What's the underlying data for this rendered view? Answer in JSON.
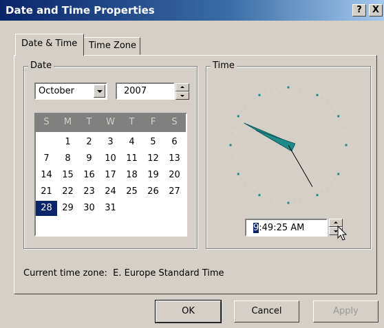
{
  "window": {
    "title": "Date and Time Properties",
    "help_label": "?",
    "close_label": "X"
  },
  "tabs": [
    {
      "label": "Date & Time",
      "active": true
    },
    {
      "label": "Time Zone",
      "active": false
    }
  ],
  "date_group": {
    "label": "Date",
    "month": "October",
    "year": "2007",
    "weekday_headers": [
      "S",
      "M",
      "T",
      "W",
      "T",
      "F",
      "S"
    ],
    "weeks": [
      [
        "",
        "1",
        "2",
        "3",
        "4",
        "5",
        "6"
      ],
      [
        "7",
        "8",
        "9",
        "10",
        "11",
        "12",
        "13"
      ],
      [
        "14",
        "15",
        "16",
        "17",
        "18",
        "19",
        "20"
      ],
      [
        "21",
        "22",
        "23",
        "24",
        "25",
        "26",
        "27"
      ],
      [
        "28",
        "29",
        "30",
        "31",
        "",
        "",
        ""
      ]
    ],
    "selected_day": "28"
  },
  "time_group": {
    "label": "Time",
    "time_hour": "9",
    "time_rest": ":49:25 AM",
    "clock": {
      "hours": 9,
      "minutes": 49,
      "seconds": 25
    }
  },
  "current_time_zone_label": "Current time zone:",
  "current_time_zone_value": "E. Europe Standard Time",
  "buttons": {
    "ok": "OK",
    "cancel": "Cancel",
    "apply": "Apply"
  },
  "colors": {
    "title_bar": "#0a246a",
    "dialog_face": "#d4d0c8",
    "clock_hands": "#1f8a8a",
    "selection": "#0a246a"
  }
}
